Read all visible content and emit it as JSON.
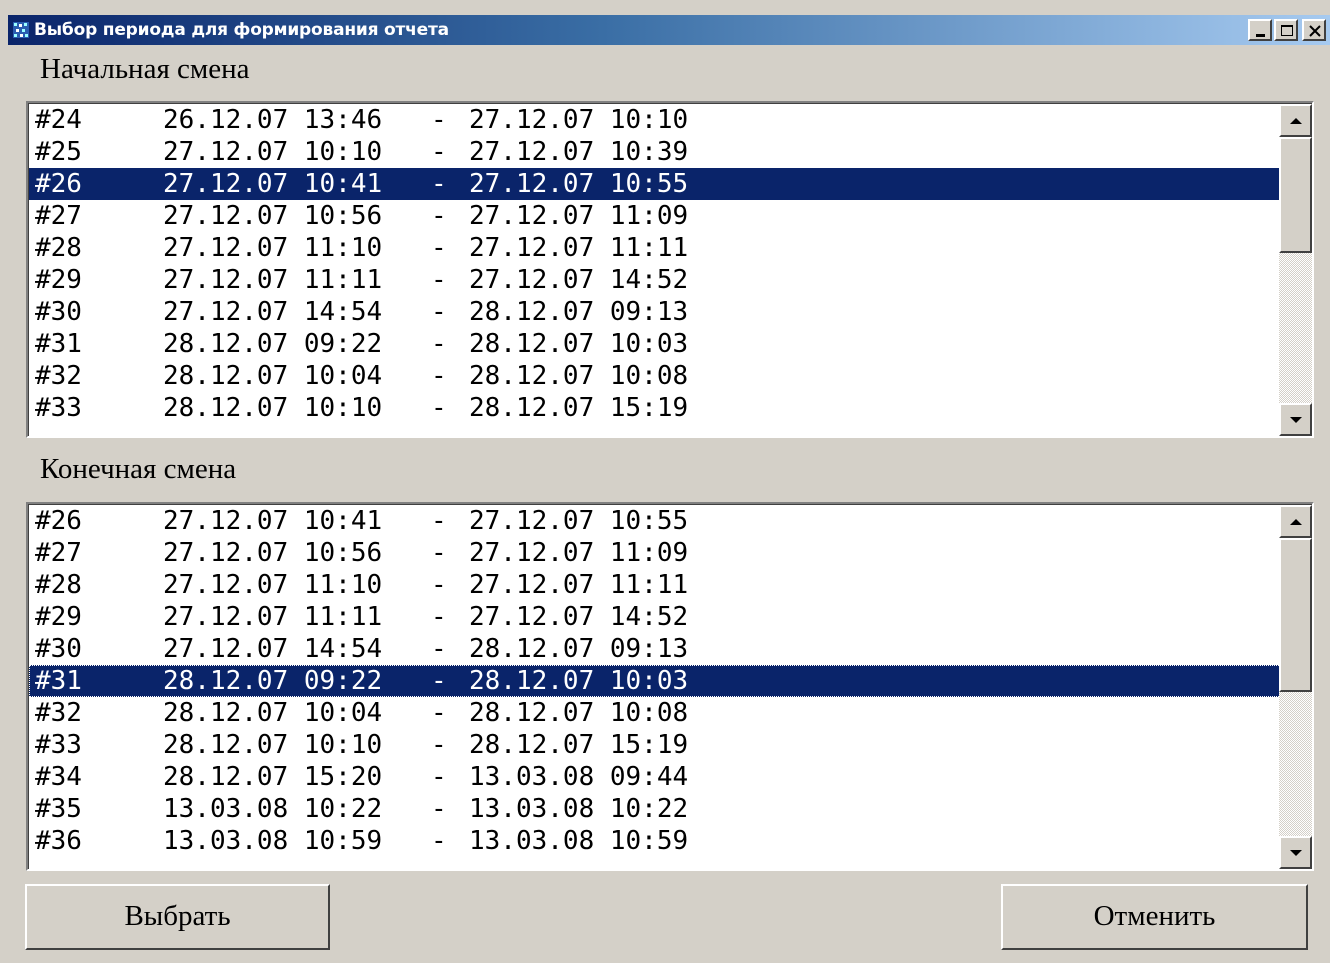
{
  "window": {
    "title": "Выбор периода для формирования отчета"
  },
  "start_section": {
    "label": "Начальная смена",
    "rows": [
      {
        "id": "#24",
        "start": "26.12.07 13:46",
        "end": "27.12.07 10:10"
      },
      {
        "id": "#25",
        "start": "27.12.07 10:10",
        "end": "27.12.07 10:39"
      },
      {
        "id": "#26",
        "start": "27.12.07 10:41",
        "end": "27.12.07 10:55"
      },
      {
        "id": "#27",
        "start": "27.12.07 10:56",
        "end": "27.12.07 11:09"
      },
      {
        "id": "#28",
        "start": "27.12.07 11:10",
        "end": "27.12.07 11:11"
      },
      {
        "id": "#29",
        "start": "27.12.07 11:11",
        "end": "27.12.07 14:52"
      },
      {
        "id": "#30",
        "start": "27.12.07 14:54",
        "end": "28.12.07 09:13"
      },
      {
        "id": "#31",
        "start": "28.12.07 09:22",
        "end": "28.12.07 10:03"
      },
      {
        "id": "#32",
        "start": "28.12.07 10:04",
        "end": "28.12.07 10:08"
      },
      {
        "id": "#33",
        "start": "28.12.07 10:10",
        "end": "28.12.07 15:19"
      }
    ],
    "selected_index": 2
  },
  "end_section": {
    "label": "Конечная смена",
    "rows": [
      {
        "id": "#26",
        "start": "27.12.07 10:41",
        "end": "27.12.07 10:55"
      },
      {
        "id": "#27",
        "start": "27.12.07 10:56",
        "end": "27.12.07 11:09"
      },
      {
        "id": "#28",
        "start": "27.12.07 11:10",
        "end": "27.12.07 11:11"
      },
      {
        "id": "#29",
        "start": "27.12.07 11:11",
        "end": "27.12.07 14:52"
      },
      {
        "id": "#30",
        "start": "27.12.07 14:54",
        "end": "28.12.07 09:13"
      },
      {
        "id": "#31",
        "start": "28.12.07 09:22",
        "end": "28.12.07 10:03"
      },
      {
        "id": "#32",
        "start": "28.12.07 10:04",
        "end": "28.12.07 10:08"
      },
      {
        "id": "#33",
        "start": "28.12.07 10:10",
        "end": "28.12.07 15:19"
      },
      {
        "id": "#34",
        "start": "28.12.07 15:20",
        "end": "13.03.08 09:44"
      },
      {
        "id": "#35",
        "start": "13.03.08 10:22",
        "end": "13.03.08 10:22"
      },
      {
        "id": "#36",
        "start": "13.03.08 10:59",
        "end": "13.03.08 10:59"
      }
    ],
    "selected_index": 5
  },
  "buttons": {
    "select_label": "Выбрать",
    "cancel_label": "Отменить"
  },
  "icons": {
    "app": "app-icon",
    "minimize": "minimize-icon",
    "maximize": "maximize-icon",
    "close": "close-icon",
    "scroll_up": "arrow-up-icon",
    "scroll_down": "arrow-down-icon"
  },
  "colors": {
    "selection": "#0a246a",
    "face": "#d4d0c8",
    "title_start": "#0a246a",
    "title_end": "#a6caf0"
  }
}
